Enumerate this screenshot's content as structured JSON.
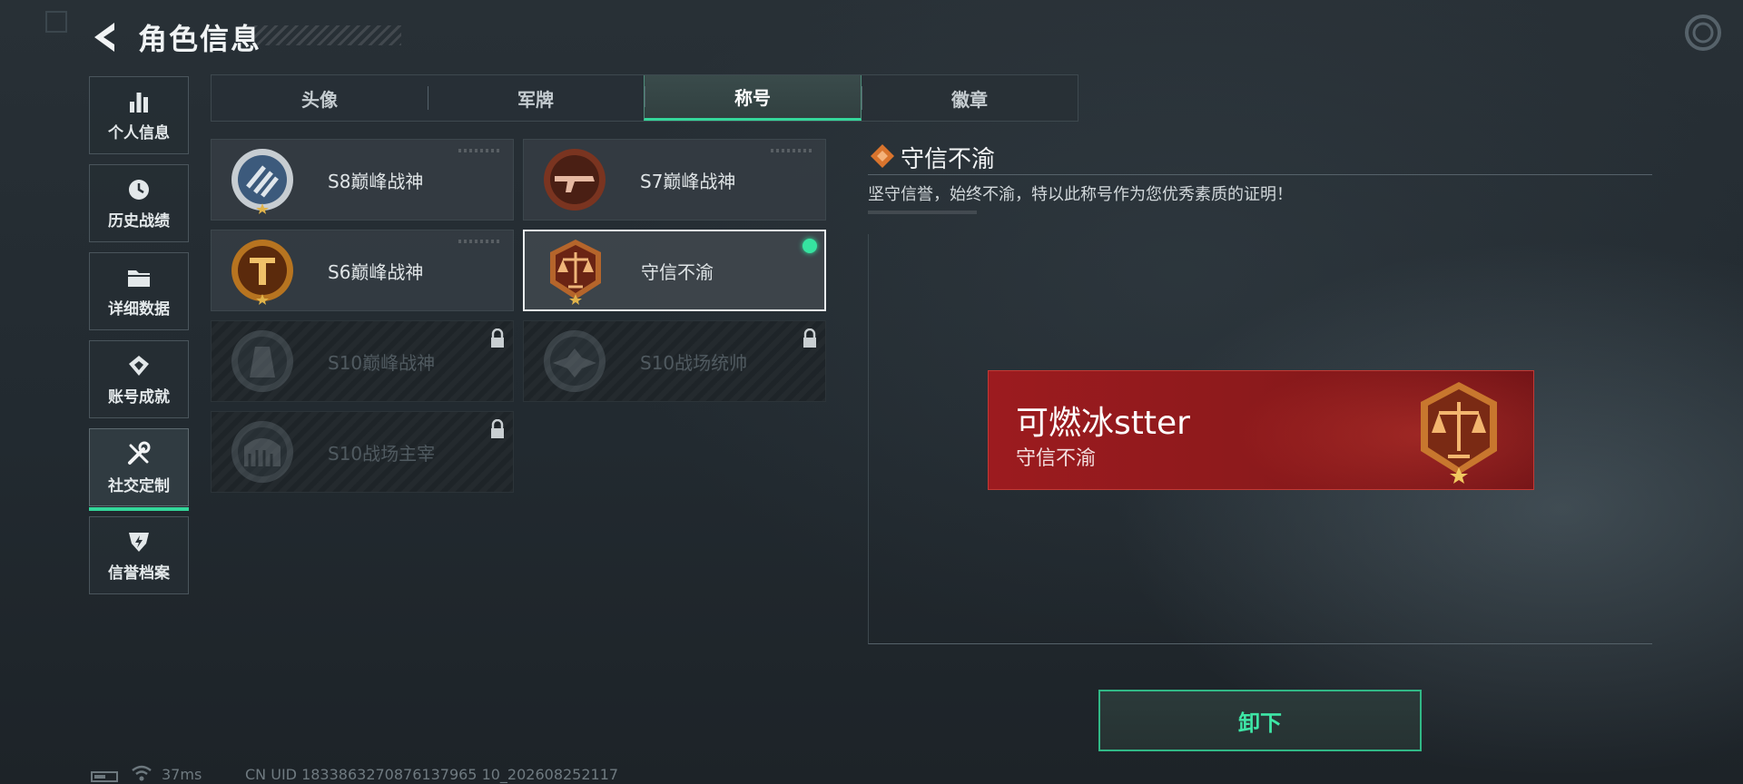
{
  "header": {
    "title": "角色信息"
  },
  "sidebar": {
    "items": [
      {
        "label": "个人信息",
        "icon": "bar-chart-icon"
      },
      {
        "label": "历史战绩",
        "icon": "history-clock-icon"
      },
      {
        "label": "详细数据",
        "icon": "folder-icon"
      },
      {
        "label": "账号成就",
        "icon": "achievement-icon"
      },
      {
        "label": "社交定制",
        "icon": "tools-icon",
        "active": true
      },
      {
        "label": "信誉档案",
        "icon": "reputation-icon"
      }
    ]
  },
  "tabs": [
    {
      "label": "头像"
    },
    {
      "label": "军牌"
    },
    {
      "label": "称号",
      "active": true
    },
    {
      "label": "徽章"
    }
  ],
  "titles": [
    {
      "name": "S8巅峰战神",
      "badge": "s8-peak-badge-icon",
      "locked": false
    },
    {
      "name": "S7巅峰战神",
      "badge": "s7-peak-badge-icon",
      "locked": false
    },
    {
      "name": "S6巅峰战神",
      "badge": "s6-peak-badge-icon",
      "locked": false
    },
    {
      "name": "守信不渝",
      "badge": "scales-badge-icon",
      "locked": false,
      "selected": true,
      "equipped": true
    },
    {
      "name": "S10巅峰战神",
      "badge": "s10-peak-badge-icon",
      "locked": true
    },
    {
      "name": "S10战场统帅",
      "badge": "s10-commander-badge-icon",
      "locked": true
    },
    {
      "name": "S10战场主宰",
      "badge": "s10-dominator-badge-icon",
      "locked": true
    }
  ],
  "detail": {
    "title": "守信不渝",
    "description": "坚守信誉，始终不渝，特以此称号作为您优秀素质的证明！"
  },
  "preview": {
    "player_name": "可燃冰stter",
    "title": "守信不渝"
  },
  "actions": {
    "unequip_label": "卸下"
  },
  "footer": {
    "ping": "37ms",
    "uid": "CN UID 1833863270876137965 10_202608252117"
  },
  "colors": {
    "accent": "#35d79b",
    "nameplate_red": "#9c1b1f",
    "gold": "#c98a2a"
  }
}
